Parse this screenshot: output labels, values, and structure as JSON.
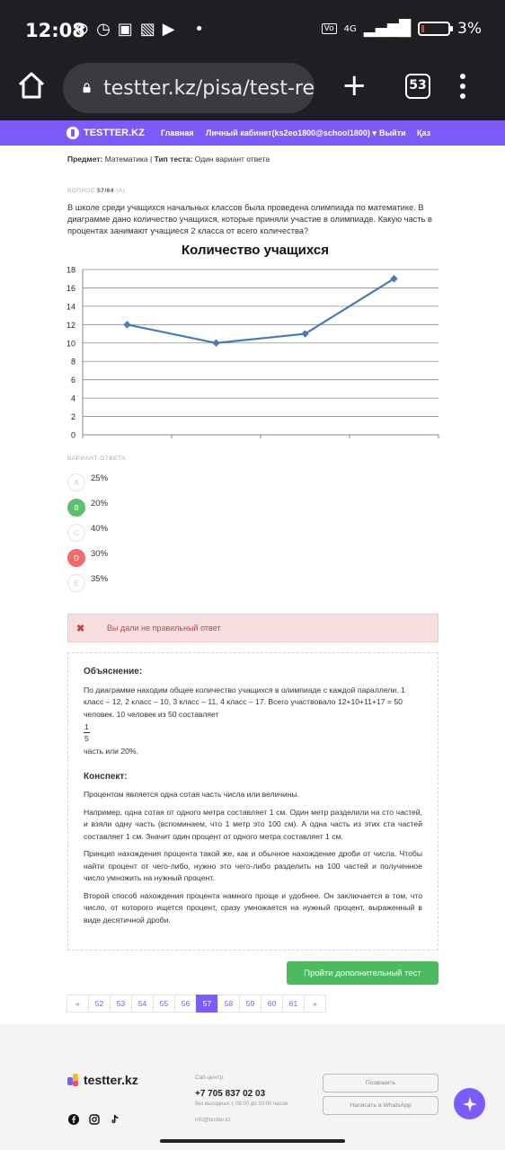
{
  "status_bar": {
    "time": "12:08",
    "network": "4G",
    "battery": "3%"
  },
  "browser": {
    "url": "testter.kz/pisa/test-re",
    "tab_count": "53"
  },
  "site_nav": {
    "logo": "TESTTER.KZ",
    "home": "Главная",
    "cabinet": "Личный кабинет(ks2eo1800@school1800)",
    "logout": "Выйти",
    "lang": "Қаз"
  },
  "meta": {
    "subject_label": "Предмет:",
    "subject": "Математика",
    "sep": "|",
    "type_label": "Тип теста:",
    "type": "Один вариант ответа"
  },
  "question": {
    "label": "ВОПРОС",
    "number": "57/64",
    "level": "(A)",
    "text": "В школе среди учащихся начальных классов была проведена олимпиада по математике. В диаграмме дано количество учащихся, которые приняли участие в олимпиаде. Какую часть в процентах занимают учащиеся 2 класса от всего количества?"
  },
  "chart_data": {
    "type": "line",
    "title": "Количество учащихся",
    "categories": [
      "1",
      "2",
      "3",
      "4"
    ],
    "x_tick_labels_visible": false,
    "series": [
      {
        "values": [
          12,
          10,
          11,
          17
        ]
      }
    ],
    "ylim": [
      0,
      18
    ],
    "yticks": [
      "0",
      "2",
      "4",
      "6",
      "8",
      "10",
      "12",
      "14",
      "16",
      "18"
    ],
    "grid": true,
    "line_color": "#4a7ab7"
  },
  "answers": {
    "label": "ВАРИАНТ ОТВЕТА",
    "options": [
      {
        "letter": "A",
        "text": "25%"
      },
      {
        "letter": "B",
        "text": "20%"
      },
      {
        "letter": "C",
        "text": "40%"
      },
      {
        "letter": "D",
        "text": "30%"
      },
      {
        "letter": "E",
        "text": "35%"
      }
    ],
    "correct": "B",
    "selected": "D"
  },
  "alert": {
    "icon": "✖",
    "text": "Вы дали не правильный ответ"
  },
  "explanation": {
    "title": "Объяснение:",
    "text": "По диаграмме находим общее количество учащихся в олимпиаде с каждой параллели. 1 класс – 12, 2 класс – 10, 3 класс – 11, 4 класс – 17. Всего участвовало 12+10+11+17 = 50 человек. 10 человек из 50 составляет",
    "frac_num": "1",
    "frac_den": "5",
    "after": "часть или 20%.",
    "summary_title": "Конспект:",
    "p1": "Процентом является одна сотая часть числа или величины.",
    "p2": "Например, одна сотая от одного метра составляет 1 см. Один метр разделили на сто частей, и взяли одну часть (вспоминаем, что 1 метр это 100 см). А одна часть из этих ста частей составляет 1 см. Значит один процент от одного метра составляет 1 см.",
    "p3": "Принцип нахождения процента такой же, как и обычное нахождение дроби от числа. Чтобы найти процент от чего-либо, нужно это чего-либо разделить на 100 частей и полученное число умножить на нужный процент.",
    "p4": "Второй способ нахождения процента намного проще и удобнее. Он заключается в том, что число, от которого ищется процент, сразу умножается на нужный процент, выраженный в виде десятичной дроби."
  },
  "more_button": "Пройти дополнительный тест",
  "pagination": {
    "prev": "«",
    "pages": [
      "52",
      "53",
      "54",
      "55",
      "56",
      "57",
      "58",
      "59",
      "60",
      "61"
    ],
    "active": "57",
    "next": "»"
  },
  "footer": {
    "logo": "testter.kz",
    "call_label": "Call-центр:",
    "phone": "+7 705 837 02 03",
    "hours": "без выходных с 08:00 до 20:00 часов",
    "email": "info@testter.kz",
    "call_button": "Позвонить",
    "whatsapp_button": "Написать в WhatsApp"
  }
}
